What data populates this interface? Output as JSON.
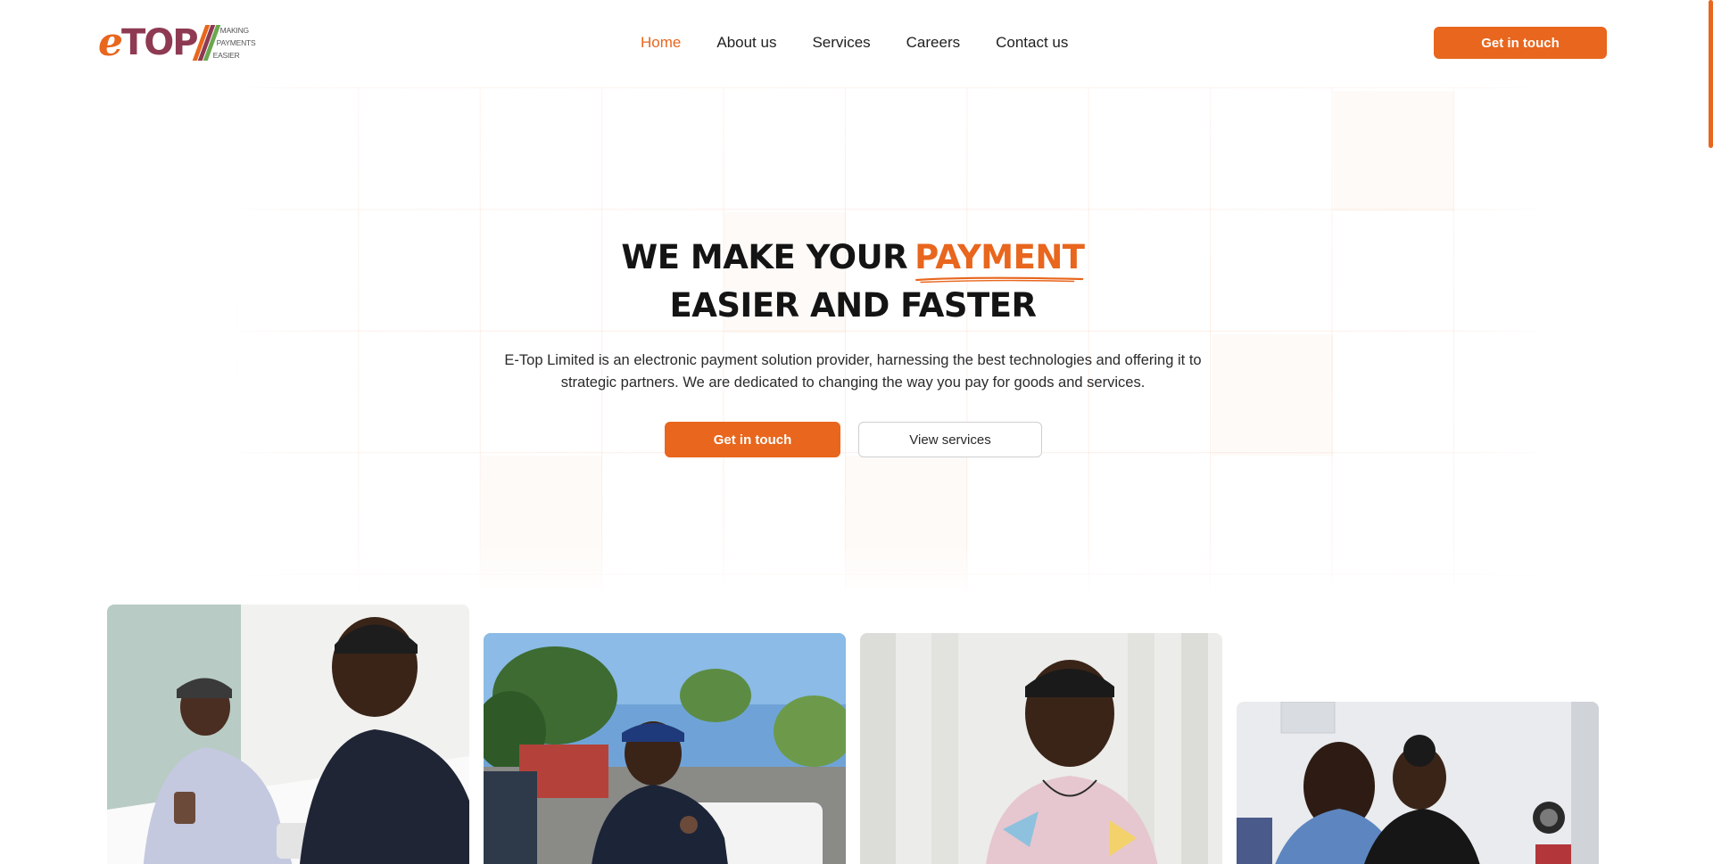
{
  "brand": {
    "logo_e": "e",
    "logo_top": "TOP",
    "tagline": [
      "MAKING",
      "PAYMENTS",
      "EASIER"
    ],
    "colors": {
      "accent": "#e8661d",
      "logo_maroon": "#8e3a52",
      "stripe_1": "#e8661d",
      "stripe_2": "#8e3a52",
      "stripe_3": "#6aa84f"
    }
  },
  "nav": {
    "items": [
      {
        "label": "Home",
        "active": true
      },
      {
        "label": "About us",
        "active": false
      },
      {
        "label": "Services",
        "active": false
      },
      {
        "label": "Careers",
        "active": false
      },
      {
        "label": "Contact us",
        "active": false
      }
    ],
    "cta_label": "Get in touch"
  },
  "hero": {
    "title_line1_prefix": "WE MAKE YOUR",
    "title_accent": "PAYMENT",
    "title_line2": "EASIER AND FASTER",
    "description": "E-Top Limited is an electronic payment solution provider, harnessing the best technologies and offering it to strategic partners. We are dedicated to changing the way you pay for goods and services.",
    "primary_button": "Get in touch",
    "secondary_button": "View services"
  },
  "gallery": {
    "photos": [
      {
        "subject": "two people at a counter with POS terminal"
      },
      {
        "subject": "rider with motorcycle delivery box outdoors"
      },
      {
        "subject": "smiling woman in floral shirt"
      },
      {
        "subject": "two people working at a desk"
      }
    ]
  }
}
